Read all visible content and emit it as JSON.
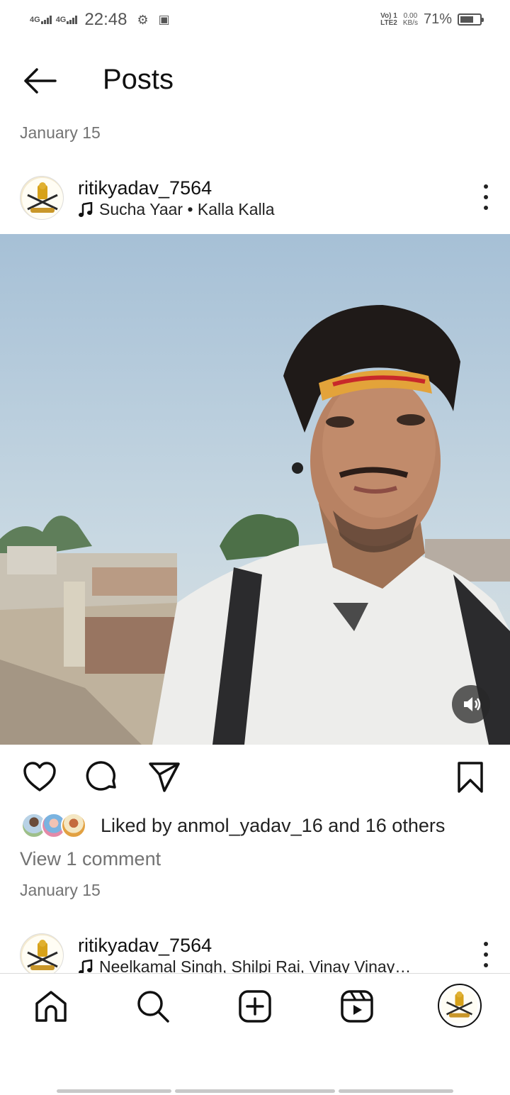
{
  "status_bar": {
    "net1": "4G",
    "net2": "4G",
    "time": "22:48",
    "volte": "Vo) 1",
    "lte": "LTE2",
    "speed_value": "0.00",
    "speed_unit": "KB/s",
    "battery": "71%",
    "battery_level": 0.71
  },
  "header": {
    "title": "Posts"
  },
  "date_top": "January 15",
  "post": {
    "username": "ritikyadav_7564",
    "music": "Sucha Yaar • Kalla Kalla",
    "liked_by": "Liked by anmol_yadav_16 and 16 others",
    "view_comments": "View 1 comment",
    "date": "January 15"
  },
  "next_post": {
    "username": "ritikyadav_7564",
    "music": "Neelkamal Singh, Shilpi Rai, Vinay Vinay…"
  },
  "icons": {
    "back": "arrow-left-icon",
    "more": "more-vertical-icon",
    "music": "music-note-icon",
    "mute": "speaker-icon",
    "like": "heart-icon",
    "comment": "comment-bubble-icon",
    "share": "paper-plane-icon",
    "save": "bookmark-icon",
    "nav": [
      "home-icon",
      "search-icon",
      "create-icon",
      "reels-icon",
      "profile-avatar"
    ]
  },
  "colors": {
    "text_primary": "#111111",
    "text_secondary": "#737373",
    "divider": "#dbdbdb",
    "sky": "#a9c3d8"
  }
}
